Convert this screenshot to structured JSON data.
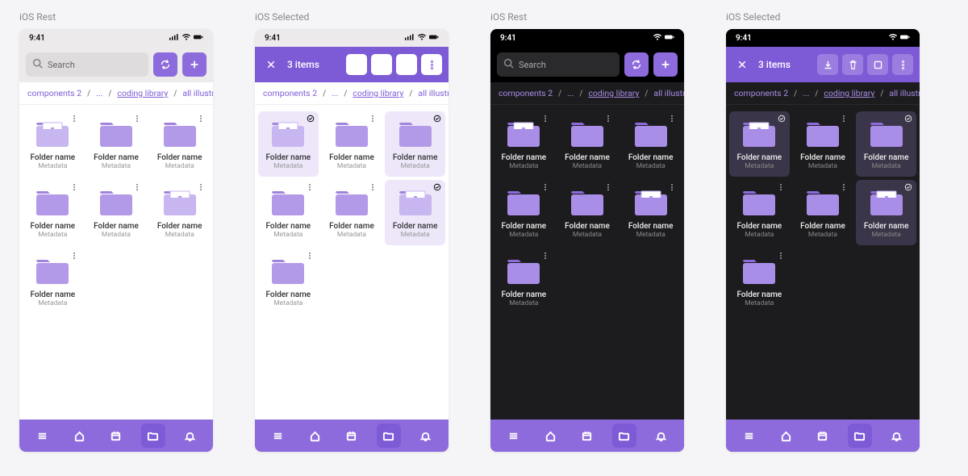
{
  "variants": [
    {
      "label": "iOS Rest",
      "theme": "light",
      "mode": "rest"
    },
    {
      "label": "iOS Selected",
      "theme": "light",
      "mode": "selected"
    },
    {
      "label": "iOS Rest",
      "theme": "dark",
      "mode": "rest"
    },
    {
      "label": "iOS Selected",
      "theme": "dark",
      "mode": "selected"
    }
  ],
  "statusbar": {
    "time": "9:41"
  },
  "search": {
    "placeholder": "Search"
  },
  "selection": {
    "count_label": "3 items"
  },
  "breadcrumbs": {
    "items": [
      {
        "label": "components 2",
        "link": false
      },
      {
        "label": "...",
        "link": false,
        "ellipsis": true
      },
      {
        "label": "coding library",
        "link": true
      },
      {
        "label": "all illustrations",
        "link": false
      }
    ],
    "sep": "/"
  },
  "folders": [
    {
      "name": "Folder name",
      "meta": "Metadata",
      "special": true
    },
    {
      "name": "Folder name",
      "meta": "Metadata",
      "special": false
    },
    {
      "name": "Folder name",
      "meta": "Metadata",
      "special": false
    },
    {
      "name": "Folder name",
      "meta": "Metadata",
      "special": false
    },
    {
      "name": "Folder name",
      "meta": "Metadata",
      "special": false
    },
    {
      "name": "Folder name",
      "meta": "Metadata",
      "special": true
    },
    {
      "name": "Folder name",
      "meta": "Metadata",
      "special": false
    }
  ],
  "selected_indices": [
    0,
    2,
    5
  ],
  "nav": {
    "items": [
      "menu",
      "home",
      "calendar",
      "folder",
      "bell"
    ],
    "active": "folder"
  },
  "icons": {
    "sync": "sync-icon",
    "plus": "plus-icon",
    "close": "close-icon",
    "download": "download-icon",
    "trash": "trash-icon",
    "square": "stop-icon",
    "more_v": "more-vertical-icon"
  }
}
